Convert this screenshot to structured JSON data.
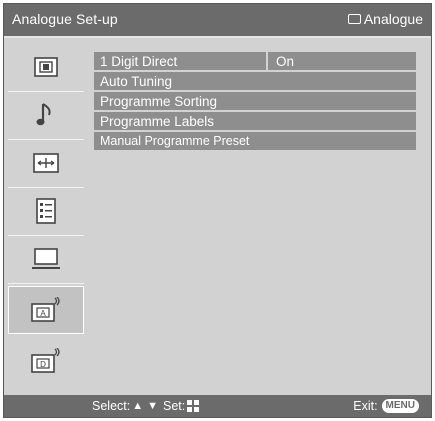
{
  "header": {
    "title": "Analogue Set-up",
    "source_label": "Analogue",
    "source_icon": "screen-icon"
  },
  "sidebar": {
    "items": [
      {
        "icon": "picture-icon",
        "selected": false
      },
      {
        "icon": "sound-icon",
        "selected": false
      },
      {
        "icon": "screen-size-icon",
        "selected": false
      },
      {
        "icon": "features-icon",
        "selected": false
      },
      {
        "icon": "pc-icon",
        "selected": false
      },
      {
        "icon": "analogue-setup-icon",
        "selected": true
      },
      {
        "icon": "digital-setup-icon",
        "selected": false
      }
    ]
  },
  "menu": {
    "items": [
      {
        "label": "1 Digit Direct",
        "value": "On"
      },
      {
        "label": "Auto Tuning"
      },
      {
        "label": "Programme Sorting"
      },
      {
        "label": "Programme Labels"
      },
      {
        "label": "Manual Programme Preset"
      }
    ]
  },
  "footer": {
    "select_label": "Select:",
    "set_label": "Set:",
    "exit_label": "Exit:",
    "menu_button": "MENU"
  },
  "colors": {
    "bar": "#6b6b6b",
    "background": "#d2d2d2",
    "row": "#8e8e8e",
    "text": "#ffffff"
  }
}
